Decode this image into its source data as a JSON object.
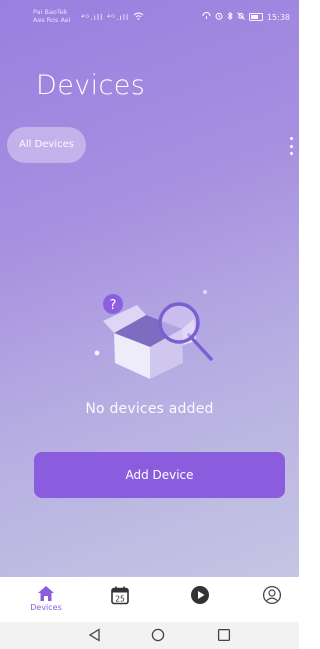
{
  "status_bar": {
    "carrier_line1": "Pai BaoTek",
    "carrier_line2": "Aes Ros Aei",
    "signal": "⁴ᴳ.ıll ⁴ᴳ.ıll",
    "time": "15:38"
  },
  "header": {
    "title": "Devices"
  },
  "filter": {
    "all_devices_label": "All Devices"
  },
  "empty_state": {
    "message": "No devices added"
  },
  "actions": {
    "add_device_label": "Add Device"
  },
  "tabbar": {
    "devices_label": "Devices",
    "calendar_day": "25",
    "accent_color": "#8c5cdf"
  },
  "icons": {
    "kebab": "more-vertical-icon",
    "home": "home-icon",
    "calendar": "calendar-icon",
    "play": "play-icon",
    "profile": "profile-icon",
    "back": "back-triangle-icon",
    "home_nav": "home-circle-icon",
    "recents": "recents-square-icon"
  }
}
